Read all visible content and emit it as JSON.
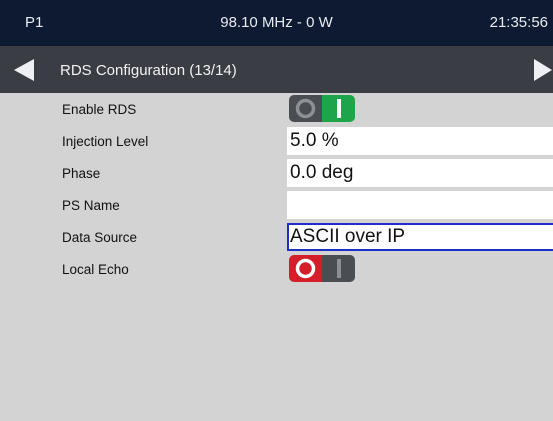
{
  "status_bar": {
    "channel": "P1",
    "frequency_power": "98.10 MHz - 0 W",
    "time": "21:35:56"
  },
  "nav": {
    "title": "RDS Configuration (13/14)",
    "prev_icon": "left-arrow-icon",
    "next_icon": "right-arrow-icon"
  },
  "settings": [
    {
      "label": "Enable RDS",
      "type": "toggle",
      "state": "on"
    },
    {
      "label": "Injection Level",
      "type": "field",
      "value": "5.0 %"
    },
    {
      "label": "Phase",
      "type": "field",
      "value": "0.0 deg"
    },
    {
      "label": "PS Name",
      "type": "field",
      "value": ""
    },
    {
      "label": "Data Source",
      "type": "field",
      "value": "ASCII over IP",
      "focused": true
    },
    {
      "label": "Local Echo",
      "type": "toggle",
      "state": "off"
    }
  ],
  "colors": {
    "status_bar_bg": "#0d1a31",
    "nav_bar_bg": "#3a3e44",
    "body_bg": "#d3d3d3",
    "toggle_on": "#1ea54a",
    "toggle_off": "#d41f2a",
    "toggle_inactive": "#4a4d52",
    "focus_border": "#1d2fc9"
  }
}
